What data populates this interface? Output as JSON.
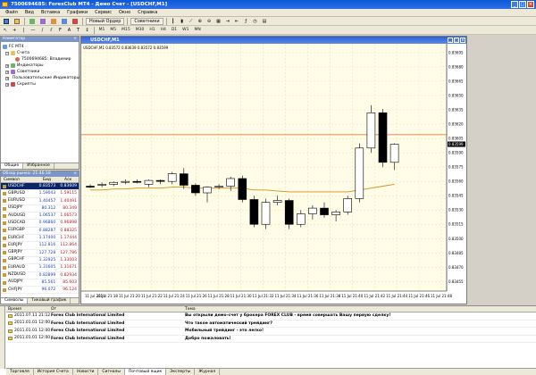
{
  "window": {
    "title": "7500694685: ForexClub MT4 - Демо Счет - [USDCHF,M1]"
  },
  "menu": [
    "Файл",
    "Вид",
    "Вставка",
    "Графики",
    "Сервис",
    "Окно",
    "Справка"
  ],
  "toolbar": {
    "new_order": "Новый Ордер",
    "experts": "Советники"
  },
  "timeframes": [
    "M1",
    "M5",
    "M15",
    "M30",
    "H1",
    "H4",
    "D1",
    "W1",
    "MN"
  ],
  "navigator": {
    "title": "Навигатор",
    "items": [
      {
        "label": "FC MT4",
        "level": 0
      },
      {
        "label": "Счета",
        "level": 1
      },
      {
        "label": "7500694685: Владимир",
        "level": 2
      },
      {
        "label": "Индикаторы",
        "level": 1
      },
      {
        "label": "Советники",
        "level": 1
      },
      {
        "label": "Пользовательские Индикаторы",
        "level": 1
      },
      {
        "label": "Скрипты",
        "level": 1
      }
    ],
    "tabs": [
      "Общие",
      "Избранное"
    ]
  },
  "market_watch": {
    "title": "Обзор рынка: 21:46:18",
    "headers": [
      "Символ",
      "Бид",
      "Аск"
    ],
    "rows": [
      {
        "symbol": "USDCHF",
        "bid": "0.83573",
        "ask": "0.83609"
      },
      {
        "symbol": "GBPUSD",
        "bid": "1.59043",
        "ask": "1.59115"
      },
      {
        "symbol": "EURUSD",
        "bid": "1.40457",
        "ask": "1.40491"
      },
      {
        "symbol": "USDJPY",
        "bid": "80.312",
        "ask": "80.349"
      },
      {
        "symbol": "AUDUSD",
        "bid": "1.06537",
        "ask": "1.06573"
      },
      {
        "symbol": "USDCAD",
        "bid": "0.96860",
        "ask": "0.96898"
      },
      {
        "symbol": "EURGBP",
        "bid": "0.88287",
        "ask": "0.88325"
      },
      {
        "symbol": "EURCHF",
        "bid": "1.17400",
        "ask": "1.17444"
      },
      {
        "symbol": "EURJPY",
        "bid": "112.816",
        "ask": "112.864"
      },
      {
        "symbol": "GBPJPY",
        "bid": "127.728",
        "ask": "127.786"
      },
      {
        "symbol": "GBPCHF",
        "bid": "1.32925",
        "ask": "1.33003"
      },
      {
        "symbol": "EURAUD",
        "bid": "1.31605",
        "ask": "1.31671"
      },
      {
        "symbol": "NZDUSD",
        "bid": "0.82899",
        "ask": "0.82934"
      },
      {
        "symbol": "AUDJPY",
        "bid": "85.561",
        "ask": "85.603"
      },
      {
        "symbol": "CHFJPY",
        "bid": "96.072",
        "ask": "96.124"
      }
    ],
    "tabs": [
      "Символы",
      "Тиковый график"
    ]
  },
  "chart": {
    "window_title": "USDCHF,M1",
    "info_line": "USDCHF,M1 0.83572 0.83639 0.83572 0.83599",
    "current_price_label": "0.83599",
    "colors": {
      "background": "#fffde8",
      "grid": "#e8e0a8",
      "bull": "#ffffff",
      "bear": "#000000",
      "ma": "#d98c1a",
      "level": "#d9651a"
    }
  },
  "chart_data": {
    "type": "candlestick",
    "symbol": "USDCHF",
    "timeframe": "M1",
    "ylim": [
      0.83445,
      0.83695
    ],
    "y_ticks": [
      "0.83695",
      "0.83680",
      "0.83665",
      "0.83650",
      "0.83635",
      "0.83620",
      "0.83605",
      "0.83590",
      "0.83575",
      "0.83560",
      "0.83545",
      "0.83530",
      "0.83515",
      "0.83500",
      "0.83485",
      "0.83470",
      "0.83455"
    ],
    "x_ticks": [
      "11 Jul 2011",
      "11 Jul 21:18",
      "11 Jul 21:20",
      "11 Jul 21:22",
      "11 Jul 21:24",
      "11 Jul 21:26",
      "11 Jul 21:28",
      "11 Jul 21:30",
      "11 Jul 21:32",
      "11 Jul 21:34",
      "11 Jul 21:36",
      "11 Jul 21:38",
      "11 Jul 21:40",
      "11 Jul 21:42",
      "11 Jul 21:44",
      "11 Jul 21:46",
      "11 Jul 21:48"
    ],
    "candles": [
      {
        "o": 0.83555,
        "h": 0.83557,
        "l": 0.83553,
        "c": 0.83554
      },
      {
        "o": 0.83556,
        "h": 0.83559,
        "l": 0.83554,
        "c": 0.83557
      },
      {
        "o": 0.83557,
        "h": 0.8356,
        "l": 0.83555,
        "c": 0.83559
      },
      {
        "o": 0.83559,
        "h": 0.83562,
        "l": 0.83557,
        "c": 0.8356
      },
      {
        "o": 0.8356,
        "h": 0.83562,
        "l": 0.83558,
        "c": 0.83559
      },
      {
        "o": 0.83557,
        "h": 0.83562,
        "l": 0.83554,
        "c": 0.83561
      },
      {
        "o": 0.83561,
        "h": 0.83562,
        "l": 0.83557,
        "c": 0.8356
      },
      {
        "o": 0.8356,
        "h": 0.8357,
        "l": 0.83557,
        "c": 0.83568
      },
      {
        "o": 0.83568,
        "h": 0.83574,
        "l": 0.83552,
        "c": 0.83556
      },
      {
        "o": 0.83556,
        "h": 0.83558,
        "l": 0.83545,
        "c": 0.83548
      },
      {
        "o": 0.83548,
        "h": 0.83555,
        "l": 0.83538,
        "c": 0.83554
      },
      {
        "o": 0.83554,
        "h": 0.83557,
        "l": 0.83552,
        "c": 0.83555
      },
      {
        "o": 0.83555,
        "h": 0.83565,
        "l": 0.8355,
        "c": 0.83563
      },
      {
        "o": 0.83563,
        "h": 0.83566,
        "l": 0.83538,
        "c": 0.83541
      },
      {
        "o": 0.83541,
        "h": 0.83545,
        "l": 0.83512,
        "c": 0.83515
      },
      {
        "o": 0.83515,
        "h": 0.83542,
        "l": 0.8351,
        "c": 0.83538
      },
      {
        "o": 0.83538,
        "h": 0.83545,
        "l": 0.83535,
        "c": 0.8354
      },
      {
        "o": 0.8354,
        "h": 0.83542,
        "l": 0.8351,
        "c": 0.83515
      },
      {
        "o": 0.83515,
        "h": 0.8353,
        "l": 0.83512,
        "c": 0.83526
      },
      {
        "o": 0.83526,
        "h": 0.83535,
        "l": 0.8352,
        "c": 0.83532
      },
      {
        "o": 0.83532,
        "h": 0.83538,
        "l": 0.83522,
        "c": 0.83525
      },
      {
        "o": 0.83525,
        "h": 0.8353,
        "l": 0.83518,
        "c": 0.83528
      },
      {
        "o": 0.83528,
        "h": 0.83545,
        "l": 0.83525,
        "c": 0.83542
      },
      {
        "o": 0.83542,
        "h": 0.836,
        "l": 0.83538,
        "c": 0.83595
      },
      {
        "o": 0.83595,
        "h": 0.8364,
        "l": 0.8359,
        "c": 0.83632
      },
      {
        "o": 0.83632,
        "h": 0.83636,
        "l": 0.83575,
        "c": 0.8358
      },
      {
        "o": 0.8358,
        "h": 0.836,
        "l": 0.83572,
        "c": 0.83599
      }
    ],
    "moving_average": [
      0.83551,
      0.83551,
      0.83552,
      0.83552,
      0.83553,
      0.83553,
      0.83553,
      0.83554,
      0.83554,
      0.83553,
      0.83553,
      0.83553,
      0.83553,
      0.83553,
      0.83551,
      0.83551,
      0.8355,
      0.83549,
      0.83549,
      0.83549,
      0.83549,
      0.83549,
      0.83549,
      0.83551,
      0.83553,
      0.83555,
      0.83557
    ],
    "horizontal_level": 0.83609,
    "current_price": 0.83599
  },
  "terminal": {
    "side_label": "Терминал",
    "headers": [
      "Время",
      "От",
      "Тема"
    ],
    "rows": [
      {
        "time": "2011.07.11 21:12",
        "from": "Forex Club International Limited",
        "subject": "Вы открыли демо-счет у брокера FOREX CLUB - время совершать Вашу первую сделку!"
      },
      {
        "time": "2011.01.01 12:00",
        "from": "Forex Club International Limited",
        "subject": "Что такое автоматический трейдинг?"
      },
      {
        "time": "2011.01.01 12:00",
        "from": "Forex Club International Limited",
        "subject": "Мобильный трейдинг - это легко!"
      },
      {
        "time": "2011.01.01 12:00",
        "from": "Forex Club International Limited",
        "subject": "Добро пожаловать!"
      }
    ],
    "tabs": [
      "Торговля",
      "История Счета",
      "Новости",
      "Сигналы",
      "Почтовый ящик",
      "Эксперты",
      "Журнал"
    ],
    "active_tab": 4
  }
}
